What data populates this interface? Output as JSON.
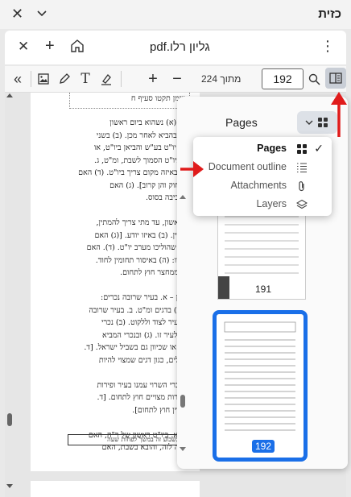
{
  "window": {
    "title": "כזית",
    "close_glyph": "✕"
  },
  "tab": {
    "title": "גליון רלו.pdf",
    "close_glyph": "✕",
    "new_glyph": "+",
    "menu_glyph": "⋮"
  },
  "toolbar": {
    "page_current": "192",
    "page_count_label": "מתוך 224",
    "zoom_in": "+",
    "zoom_out": "−",
    "text_tool": "T",
    "collapse_glyph": "«"
  },
  "document": {
    "header_text": "מימן תקטו סעיף ח",
    "lines": [
      "ימים: (א) נשהוא ביום ראשון",
      "לילה ובהביא לאחר מכן. (ב) בשני",
      "שהיה יו\"ט בע\"ש והביאן ביו\"ט, או",
      "ליהן ביו\"ט הסמוך לשבת, ומ\"ט, ג.",
      "ה (ו) באיזה מקום צריך ביו\"ט. (ד) האם",
      "כלן רחוק והן קרוב]. (ג) האם",
      "ע\"י רכיבה בסוס.",
      "",
      "ו\"ט ראשון, עד מתי צריך להמתין,",
      "משערין. (ב) באיזו יודע. [(ג) האם",
      "עליהו שהוליכו מערב יו\"ט. (ד). האם",
      "לאחריו: (ה) באיסור תחומין לחוד.",
      "שבת ממחצר חוץ לתחום.",
      "",
      "ה הדין – א. בעיר שרובה נכרים:",
      "גוי. (ב) בדגים ומ\"ט. ב. בעיר שרובה",
      "חוץ לעיר לצוד וללקוט. (ב) נכרי",
      "תמיד לעיר זו. (ג) ובנכרי המביא",
      "לעיר. או שכיוון גם בשביל ישראל. [ד.",
      "ישראלים, כגון דגים שמצוי להיות",
      "",
      "א. בנכרי השרוי עמנו בעיר ופירות",
      "אין פירות מצויים חוץ לתחום. [ד.",
      "מחוברין חוץ לתחום].",
      "",
      "אל – א. ביו\"ט ראשון של ר\"ה, האם",
      "טים זה לזה, והובא בשבת, האם"
    ],
    "footer_text": "השבועי בשבוע זה במשך לפחות שעה"
  },
  "sidebar": {
    "title": "Pages",
    "thumbnails": [
      {
        "page": "191"
      },
      {
        "page": "192",
        "selected": true
      }
    ]
  },
  "view_menu": {
    "items": [
      {
        "label": "Pages",
        "icon": "grid-icon",
        "checked": true
      },
      {
        "label": "Document outline",
        "icon": "outline-list-icon",
        "checked": false
      },
      {
        "label": "Attachments",
        "icon": "paperclip-icon",
        "checked": false
      },
      {
        "label": "Layers",
        "icon": "layers-icon",
        "checked": false
      }
    ],
    "check_glyph": "✓"
  },
  "colors": {
    "accent_blue": "#1a6fe8",
    "annotation_red": "#e01b1b",
    "toggle_bg": "#c9ced6"
  }
}
